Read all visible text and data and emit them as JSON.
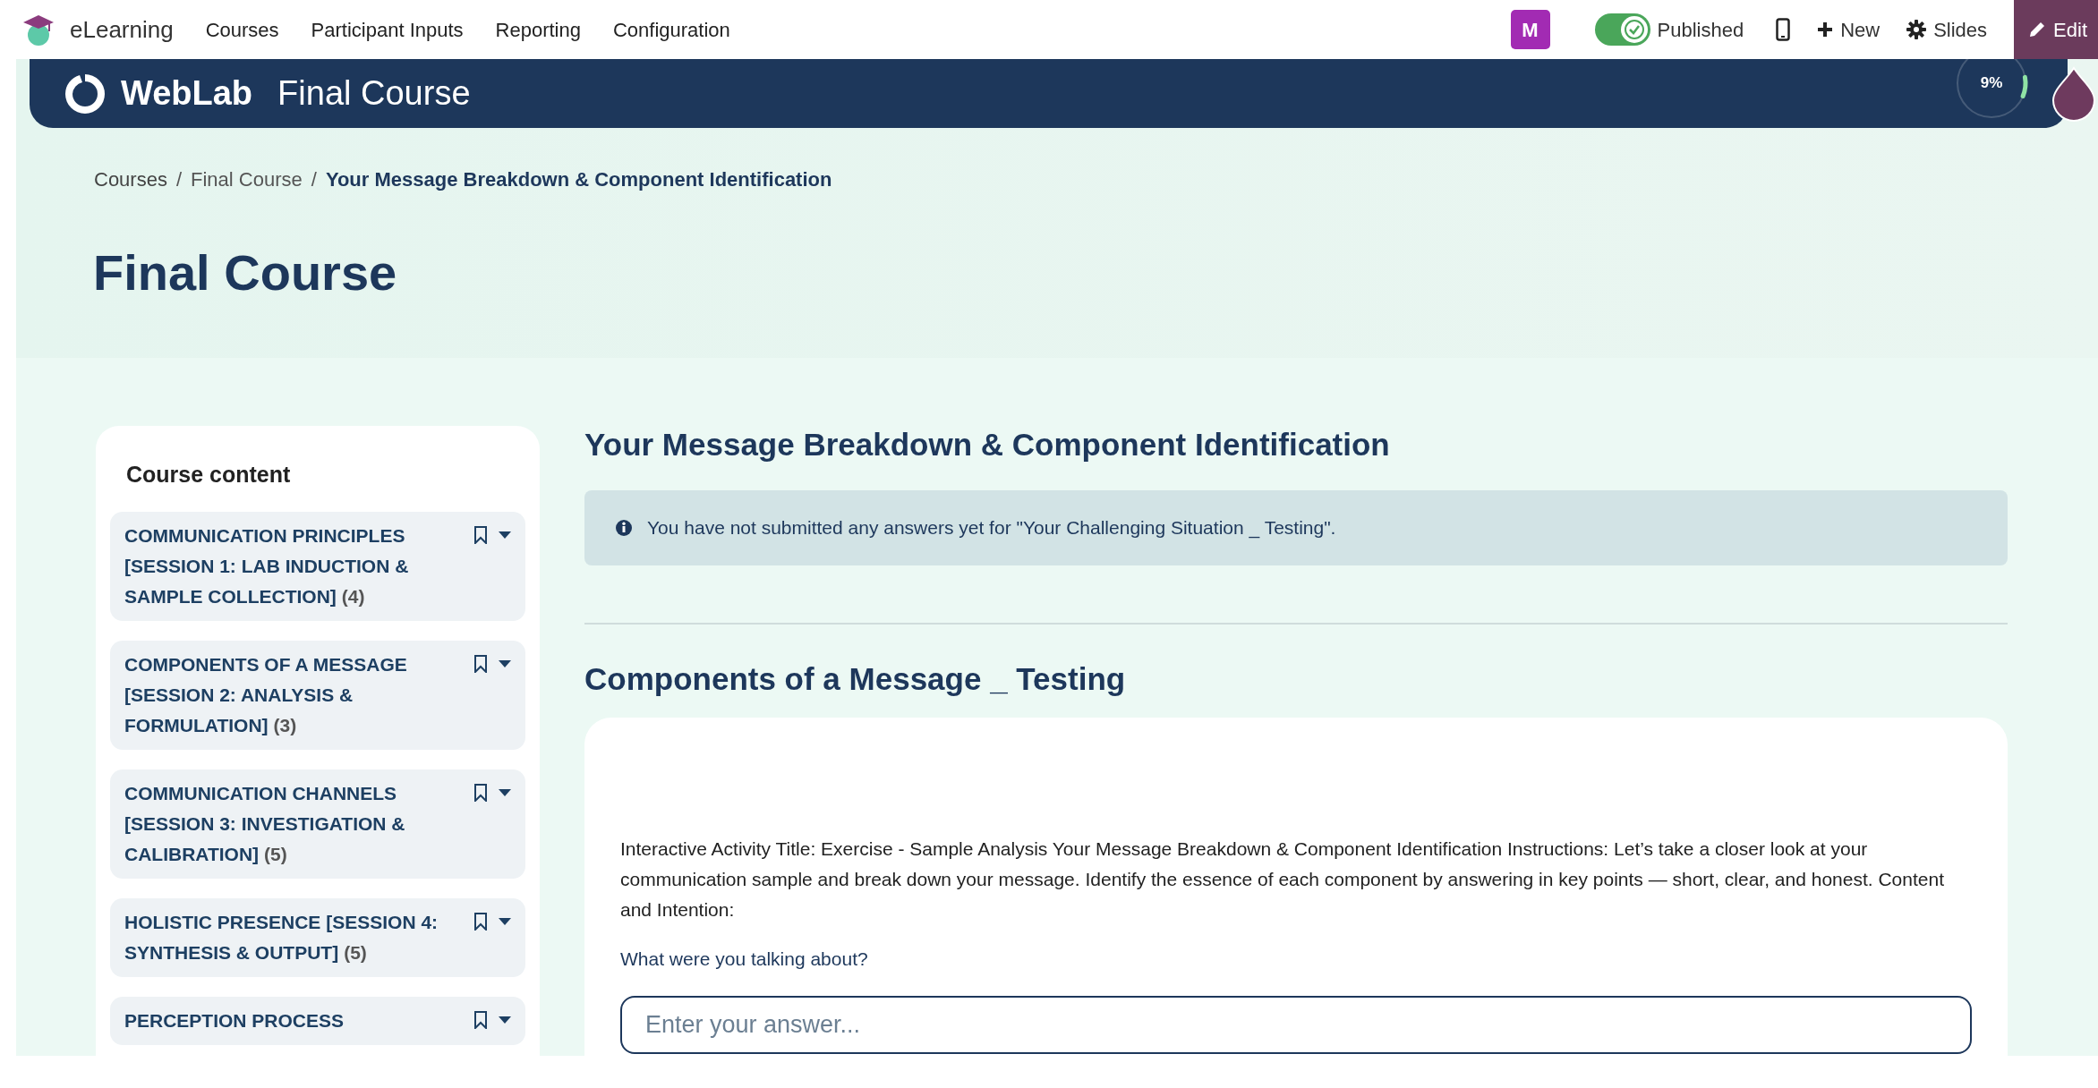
{
  "navbar": {
    "app": "eLearning",
    "menu": [
      "Courses",
      "Participant Inputs",
      "Reporting",
      "Configuration"
    ],
    "avatar": "M",
    "published": {
      "label": "Published",
      "on": true
    },
    "actions": [
      {
        "kind": "mobile"
      },
      {
        "kind": "new",
        "label": "New"
      },
      {
        "kind": "slides",
        "label": "Slides"
      },
      {
        "kind": "edit",
        "label": "Edit"
      }
    ]
  },
  "header": {
    "logo": "WebLab",
    "title": "Final Course",
    "progress": {
      "level": 0.09,
      "label": "9%"
    }
  },
  "breadcrumb": [
    {
      "label": "Courses",
      "current": false
    },
    {
      "separator": "/",
      "label": "Final Course",
      "current": false
    },
    {
      "separator": "/",
      "label": "Your Message Breakdown & Component Identification",
      "current": true
    }
  ],
  "page_title": "Final Course",
  "sidebar": {
    "title": "Course content",
    "sections": [
      {
        "title": "COMMUNICATION PRINCIPLES [SESSION 1: LAB INDUCTION & SAMPLE COLLECTION]",
        "count": "(4)"
      },
      {
        "title": "COMPONENTS OF A MESSAGE [SESSION 2: ANALYSIS & FORMULATION]",
        "count": "(3)"
      },
      {
        "title": "COMMUNICATION CHANNELS [SESSION 3: INVESTIGATION & CALIBRATION]",
        "count": "(5)"
      },
      {
        "title": "HOLISTIC PRESENCE [SESSION 4: SYNTHESIS & OUTPUT]",
        "count": "(5)"
      },
      {
        "title": "PERCEPTION PROCESS"
      }
    ]
  },
  "main": {
    "title": "Your Message Breakdown & Component Identification",
    "alert": "You have not submitted any answers yet for \"Your Challenging Situation _ Testing\".",
    "section_title": "Components of a Message _ Testing",
    "instructions": "Interactive Activity Title: Exercise - Sample Analysis Your Message Breakdown & Component Identification Instructions: Let’s take a closer look at your communication sample and break down your message. Identify the essence of each component by answering in key points — short, clear, and honest. Content and Intention:",
    "question": "What were you talking about?",
    "answer": {
      "placeholder": "Enter your answer..."
    }
  }
}
